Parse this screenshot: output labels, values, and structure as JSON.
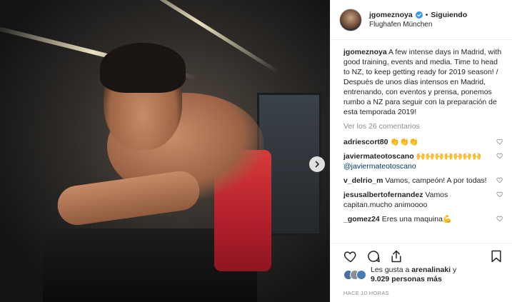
{
  "post": {
    "username": "jgomeznoya",
    "follow_label": "Siguiendo",
    "location": "Flughafen München",
    "separator": "•"
  },
  "caption": {
    "username": "jgomeznoya",
    "text": "A few intense days in Madrid, with good training, events and media. Time to head to NZ, to keep getting ready for 2019 season! / Después de unos días intensos en Madrid, entrenando, con eventos y prensa, ponemos rumbo a NZ para seguir con la preparación de esta temporada 2019!"
  },
  "view_all_comments": "Ver los 26 comentarios",
  "comments": [
    {
      "username": "adriescort80",
      "text": "👏👏👏"
    },
    {
      "username": "javiermateotoscano",
      "text": "🙌🙌🙌🙌🙌🙌🙌",
      "mention": "@javiermateotoscano"
    },
    {
      "username": "v_delrio_m",
      "text": "Vamos, campeón! A por todas!"
    },
    {
      "username": "jesusalbertofernandez",
      "text": "Vamos capitan.mucho animoooo"
    },
    {
      "username": "_gomez24",
      "text": "Eres una maquina💪"
    }
  ],
  "likes": {
    "prefix": "Les gusta a",
    "user": "arenalinaki",
    "joiner": "y",
    "count_text": "9.029 personas más"
  },
  "timestamp": "HACE 10 HORAS",
  "icons": {
    "verified": "verified-badge-icon",
    "heart": "heart-icon",
    "comment": "comment-icon",
    "share": "share-icon",
    "save": "bookmark-icon",
    "next": "chevron-right-icon"
  },
  "colors": {
    "verified": "#3897f0",
    "muted": "#8e8e8e",
    "mention": "#00376b"
  }
}
